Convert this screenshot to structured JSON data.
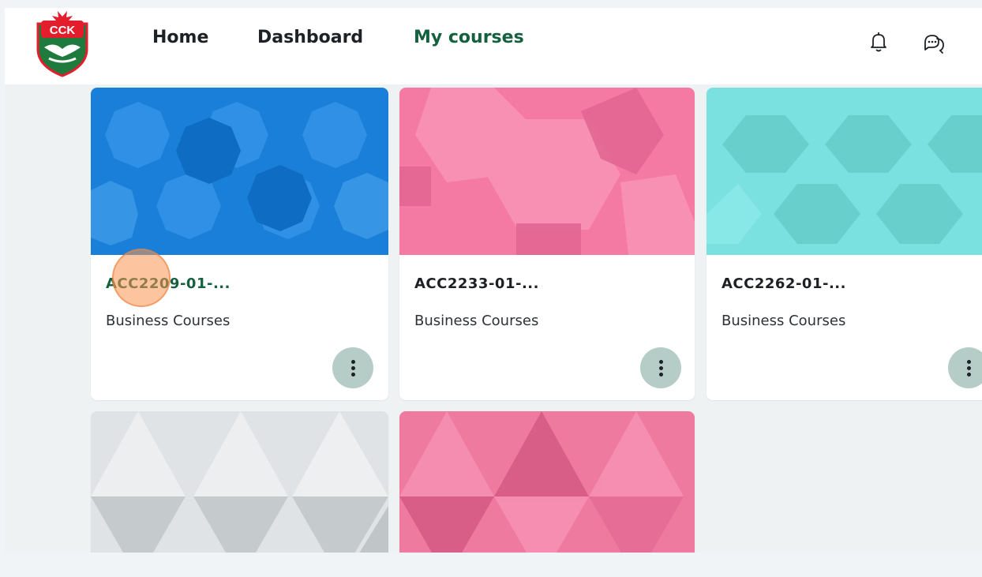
{
  "brand": {
    "logo_text": "CCK",
    "colors": {
      "red": "#e31d2b",
      "green": "#1f7a3e"
    }
  },
  "nav": {
    "items": [
      {
        "label": "Home",
        "active": false
      },
      {
        "label": "Dashboard",
        "active": false
      },
      {
        "label": "My courses",
        "active": true
      }
    ],
    "icons": [
      "bell-icon",
      "chat-icon"
    ]
  },
  "courses": [
    {
      "title": "ACC2209-01-...",
      "category": "Business Courses",
      "pattern_color": "#1a7fd8",
      "is_link": true
    },
    {
      "title": "ACC2233-01-...",
      "category": "Business Courses",
      "pattern_color": "#f57aa3",
      "is_link": false
    },
    {
      "title": "ACC2262-01-...",
      "category": "Business Courses",
      "pattern_color": "#7ae0e0",
      "is_link": false
    },
    {
      "title": "",
      "category": "",
      "pattern_color": "#d8dde0"
    },
    {
      "title": "",
      "category": "",
      "pattern_color": "#ef7aa0"
    }
  ],
  "colors": {
    "active_nav": "#15603f",
    "more_button": "#b5cdc6",
    "page_bg": "#eef2f2"
  }
}
